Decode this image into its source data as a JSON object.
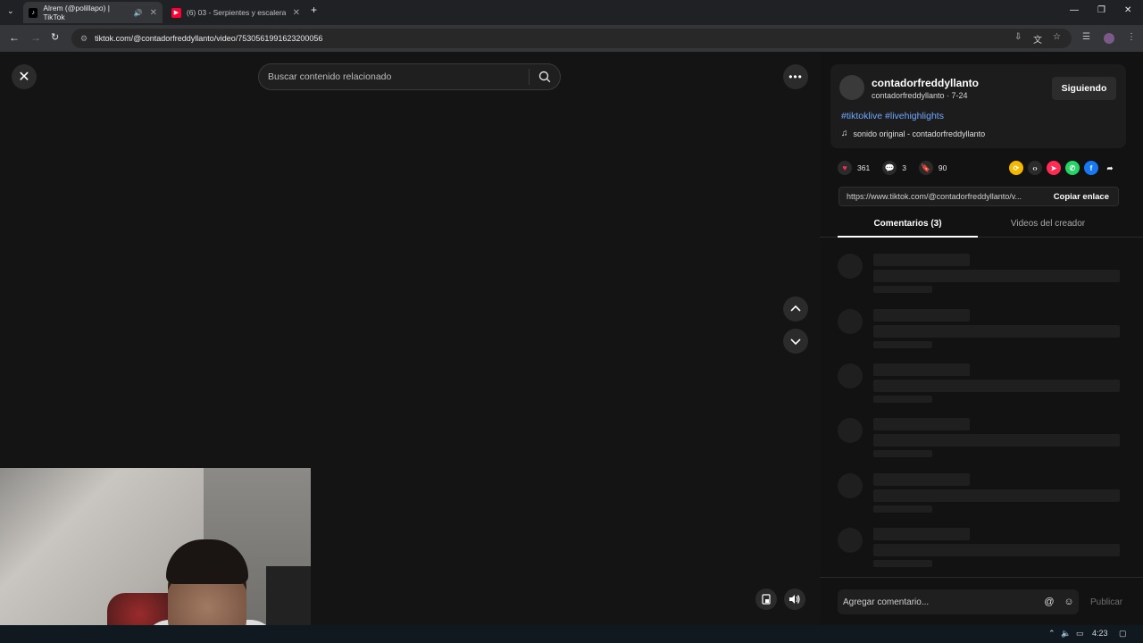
{
  "browser": {
    "tabs": [
      {
        "title": "Alrem (@polillapo) | TikTok",
        "active": true
      },
      {
        "title": "(6) 03 - Serpientes y escaleras",
        "active": false
      }
    ],
    "url": "tiktok.com/@contadorfreddyllanto/video/7530561991623200056"
  },
  "viewer": {
    "search_placeholder": "Buscar contenido relacionado"
  },
  "post": {
    "username": "contadorfreddyllanto",
    "subline": "contadorfreddyllanto · 7-24",
    "follow_label": "Siguiendo",
    "hashtags": "#tiktoklive #livehighlights",
    "sound": "sonido original - contadorfreddyllanto",
    "likes": "361",
    "comments": "3",
    "saves": "90",
    "share_url": "https://www.tiktok.com/@contadorfreddyllanto/v...",
    "copy_label": "Copiar enlace"
  },
  "tabs": {
    "comments": "Comentarios (3)",
    "creator_videos": "Videos del creador"
  },
  "comment_bar": {
    "placeholder": "Agregar comentario...",
    "publish": "Publicar"
  },
  "taskbar": {
    "time": "4:23"
  },
  "colors": {
    "accent_heart": "#fe2c55",
    "hashtag": "#6fa8ff"
  }
}
